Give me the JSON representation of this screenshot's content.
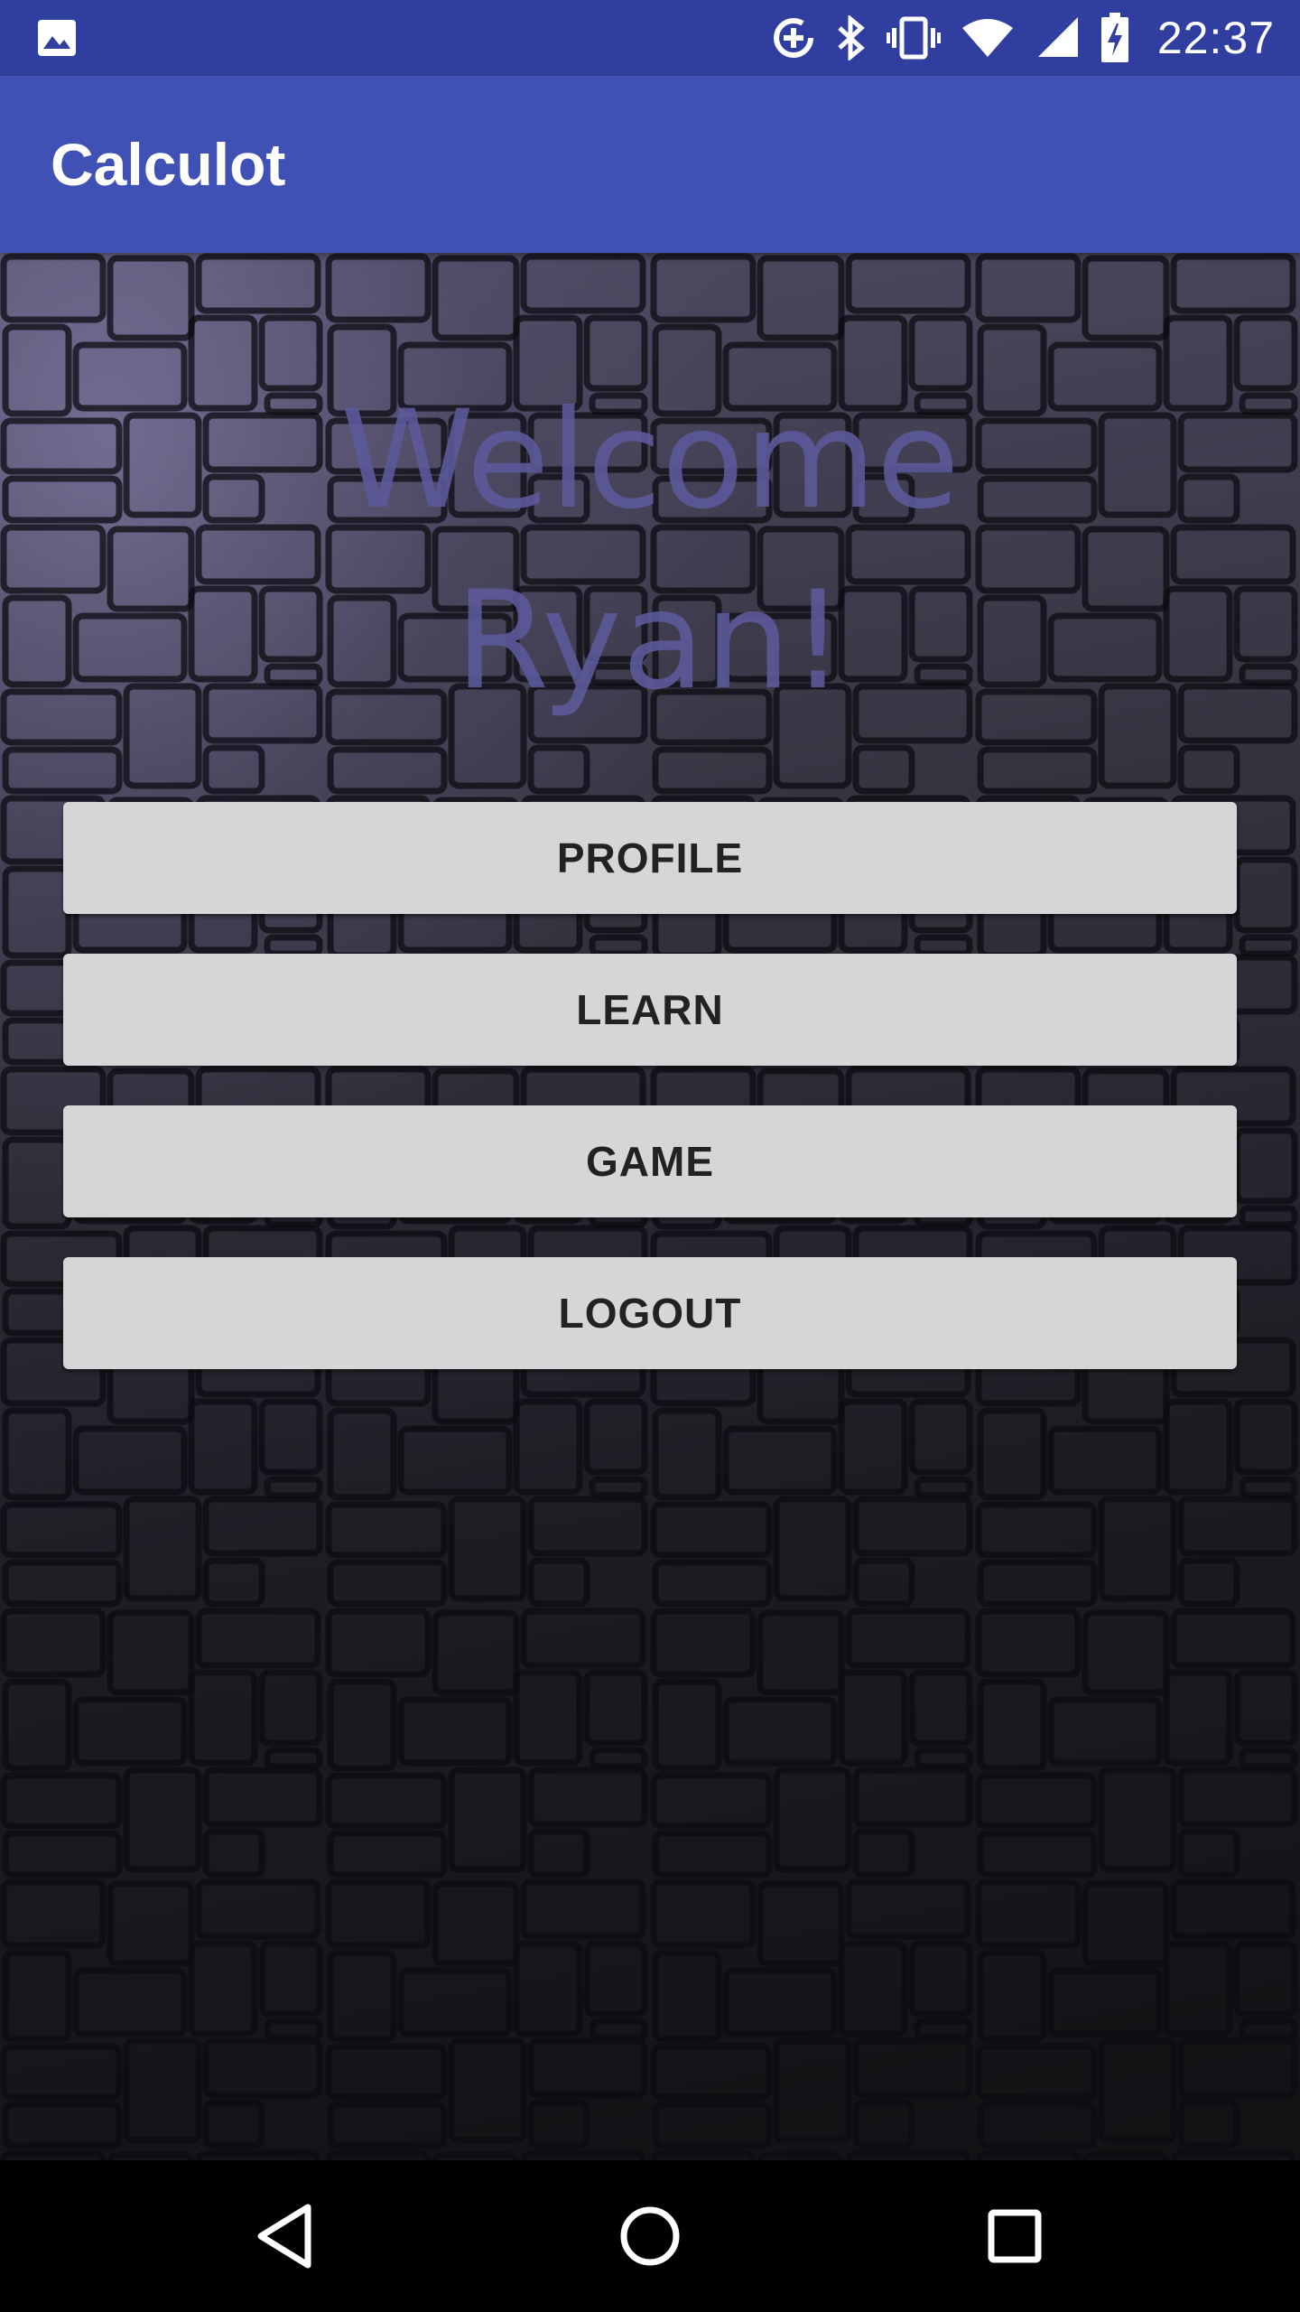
{
  "status_bar": {
    "time": "22:37",
    "icons": [
      "image-notification-icon",
      "data-saver-icon",
      "bluetooth-icon",
      "vibrate-icon",
      "wifi-icon",
      "signal-icon",
      "battery-charging-icon"
    ]
  },
  "app_bar": {
    "title": "Calculot"
  },
  "welcome": {
    "line1": "Welcome",
    "line2": "Ryan!"
  },
  "buttons": [
    {
      "label": "PROFILE"
    },
    {
      "label": "LEARN"
    },
    {
      "label": "GAME"
    },
    {
      "label": "LOGOUT"
    }
  ],
  "nav_bar": {
    "icons": [
      "back-icon",
      "home-icon",
      "recents-icon"
    ]
  },
  "colors": {
    "status_bar": "#303f9f",
    "app_bar": "#3f51b5",
    "button_bg": "#d6d6d6",
    "welcome_text": "#5c5a9a"
  }
}
